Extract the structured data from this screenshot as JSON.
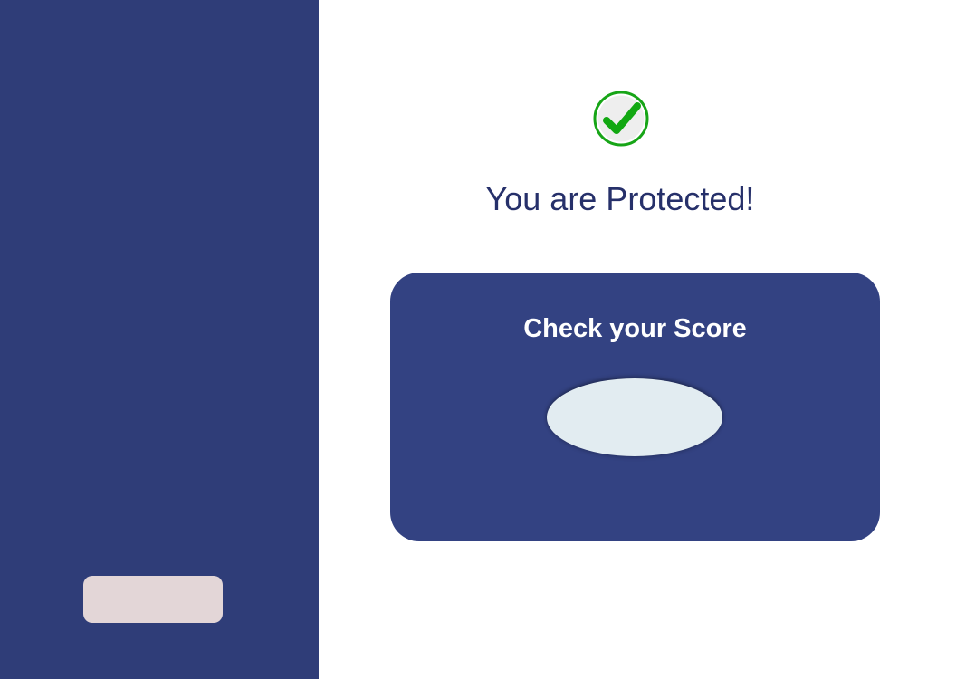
{
  "status": {
    "icon": "check-circle-icon",
    "title": "You are Protected!"
  },
  "score_card": {
    "title": "Check your Score",
    "button_label": ""
  },
  "sidebar": {
    "button_label": ""
  },
  "colors": {
    "sidebar": "#2f3d78",
    "card": "#334282",
    "title_text": "#26306a",
    "check_green": "#1fb31f",
    "oval": "#e2ecf1",
    "sidebar_button": "#e3d6d7"
  }
}
